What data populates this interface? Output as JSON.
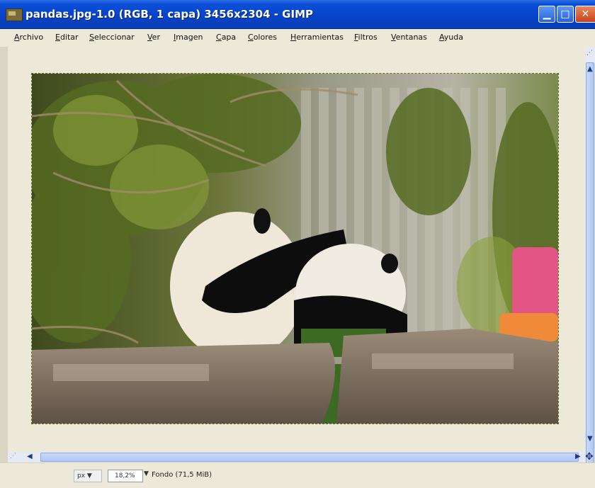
{
  "window": {
    "title": "pandas.jpg-1.0 (RGB, 1 capa) 3456x2304 - GIMP",
    "minimize_glyph": "▁",
    "maximize_glyph": "□",
    "close_glyph": "✕"
  },
  "menubar": {
    "items": [
      {
        "label": "Archivo",
        "u": "A",
        "rest": "rchivo"
      },
      {
        "label": "Editar",
        "u": "E",
        "rest": "ditar"
      },
      {
        "label": "Seleccionar",
        "u": "S",
        "rest": "eleccionar"
      },
      {
        "label": "Ver",
        "u": "V",
        "rest": "er"
      },
      {
        "label": "Imagen",
        "u": "I",
        "rest": "magen"
      },
      {
        "label": "Capa",
        "u": "C",
        "rest": "apa"
      },
      {
        "label": "Colores",
        "u": "C",
        "rest": "olores"
      },
      {
        "label": "Herramientas",
        "u": "H",
        "rest": "erramientas"
      },
      {
        "label": "Filtros",
        "u": "F",
        "rest": "iltros"
      },
      {
        "label": "Ventanas",
        "u": "V",
        "rest": "entanas"
      },
      {
        "label": "Ayuda",
        "u": "A",
        "rest": "yuda"
      }
    ]
  },
  "scrollbars": {
    "up": "▲",
    "down": "▼",
    "left": "◀",
    "right": "▶",
    "navigate": "✥",
    "corner": "⋰"
  },
  "statusbar": {
    "unit": "px",
    "unit_arrow": "▼",
    "zoom": "18,2%",
    "zoom_arrow": "▼",
    "layer_info": "Fondo (71,5 MiB)"
  },
  "colors": {
    "titlebar": "#0842c8",
    "workspace": "#ece9d8",
    "scroll_thumb": "#b1c8f5"
  },
  "icons": [
    "gimp-app-icon",
    "minimize-icon",
    "maximize-icon",
    "close-icon",
    "navigate-icon",
    "scroll-up-icon",
    "scroll-down-icon",
    "scroll-left-icon",
    "scroll-right-icon"
  ]
}
